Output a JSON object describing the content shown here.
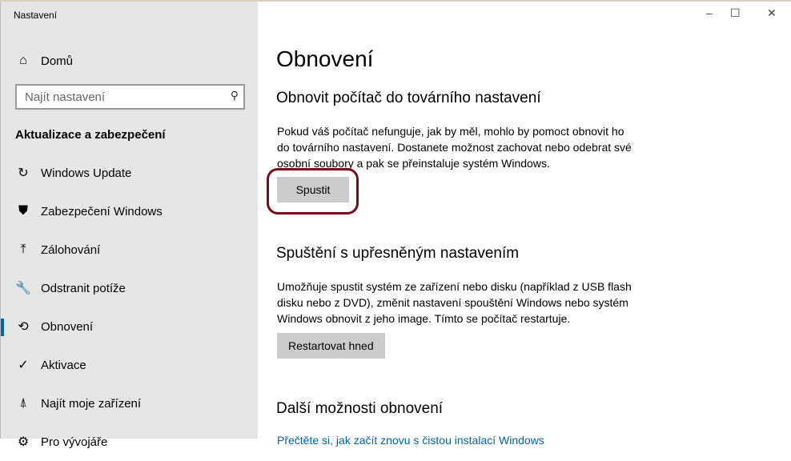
{
  "window": {
    "title": "Nastavení",
    "minimize": "–",
    "maximize": "☐",
    "close": "✕"
  },
  "sidebar": {
    "home": "Domů",
    "search_placeholder": "Najít nastavení",
    "section": "Aktualizace a zabezpečení",
    "items": [
      {
        "label": "Windows Update",
        "icon": "↻"
      },
      {
        "label": "Zabezpečení Windows",
        "icon": "⛊"
      },
      {
        "label": "Zálohování",
        "icon": "⤒"
      },
      {
        "label": "Odstranit potíže",
        "icon": "🔧"
      },
      {
        "label": "Obnovení",
        "icon": "⟲"
      },
      {
        "label": "Aktivace",
        "icon": "✓"
      },
      {
        "label": "Najít moje zařízení",
        "icon": "⍋"
      },
      {
        "label": "Pro vývojáře",
        "icon": "⚙"
      }
    ],
    "active": "Obnovení"
  },
  "main": {
    "title": "Obnovení",
    "reset": {
      "heading": "Obnovit počítač do továrního nastavení",
      "text": "Pokud váš počítač nefunguje, jak by měl, mohlo by pomoct obnovit ho do továrního nastavení. Dostanete možnost zachovat nebo odebrat své osobní soubory a pak se přeinstaluje systém Windows.",
      "button": "Spustit"
    },
    "advanced": {
      "heading": "Spuštění s upřesněným nastavením",
      "text": "Umožňuje spustit systém ze zařízení nebo disku (například z USB flash disku nebo z DVD), změnit nastavení spouštění Windows nebo systém Windows obnovit z jeho image. Tímto se počítač restartuje.",
      "button": "Restartovat hned"
    },
    "more": {
      "heading": "Další možnosti obnovení",
      "link": "Přečtěte si, jak začít znovu s čistou instalací Windows"
    }
  },
  "colors": {
    "accent": "#0063b1",
    "highlight": "#7a0a1e"
  }
}
